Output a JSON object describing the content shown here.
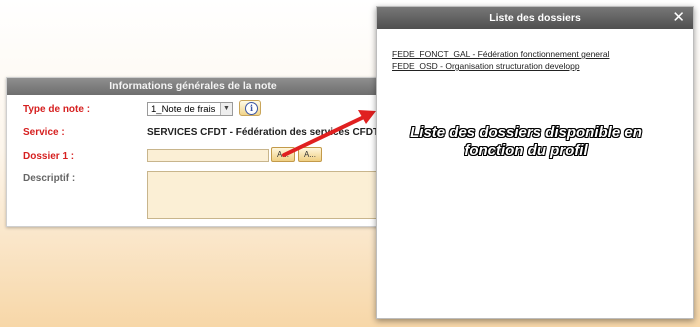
{
  "form": {
    "title": "Informations générales de la note",
    "type_label": "Type de note :",
    "type_value": "1_Note de frais",
    "service_label": "Service :",
    "service_value": "SERVICES CFDT - Fédération des services CFDT",
    "dossier_label": "Dossier 1 :",
    "dossier_value": "",
    "descriptif_label": "Descriptif :",
    "descriptif_value": "",
    "lookup1_label": "A...",
    "lookup2_label": "A..."
  },
  "modal": {
    "title": "Liste des dossiers",
    "close_glyph": "✕",
    "items": [
      "FEDE_FONCT_GAL - Fédération fonctionnement general",
      "FEDE_OSD - Organisation structuration developp"
    ]
  },
  "callout": {
    "text": "Liste des dossiers disponible en fonction du profil"
  },
  "icons": {
    "info": "info-icon",
    "dropdown": "chevron-down-icon",
    "close": "close-icon",
    "arrow": "red-arrow-annotation"
  },
  "colors": {
    "label_red": "#d62020",
    "header_gray": "#6e6e6e",
    "input_bg": "#fbefd5",
    "arrow_red": "#e02020"
  }
}
